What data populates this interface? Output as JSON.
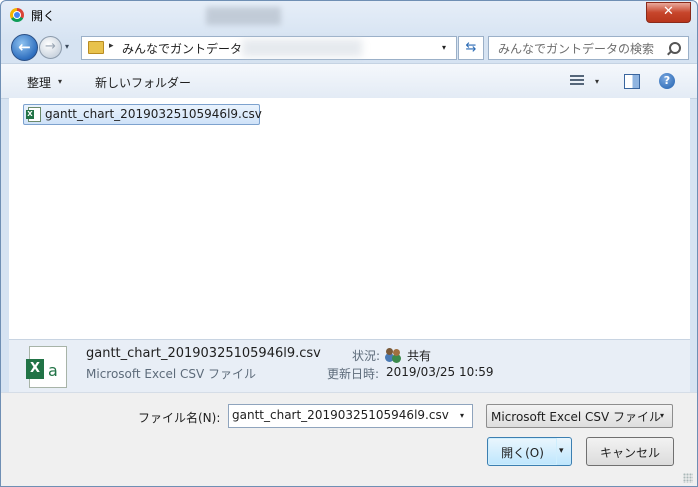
{
  "window": {
    "title": "開く",
    "close_glyph": "✕"
  },
  "address": {
    "breadcrumb_arrow": "▸",
    "path": "みんなでガントデータ",
    "dropdown_glyph": "▾",
    "refresh_glyph": "⇆"
  },
  "search": {
    "placeholder": "みんなでガントデータの検索"
  },
  "nav": {
    "back_glyph": "←",
    "forward_glyph": "→",
    "recent_glyph": "▾"
  },
  "toolbar": {
    "organize_label": "整理",
    "organize_caret": "▾",
    "new_folder_label": "新しいフォルダー",
    "view_caret": "▾",
    "help_glyph": "?"
  },
  "files": [
    {
      "name": "gantt_chart_20190325105946l9.csv",
      "selected": true
    }
  ],
  "details": {
    "name": "gantt_chart_20190325105946l9.csv",
    "type": "Microsoft Excel CSV ファイル",
    "status_label": "状況:",
    "status_value": "共有",
    "modified_label": "更新日時:",
    "modified_value": "2019/03/25 10:59"
  },
  "bottom": {
    "filename_label": "ファイル名(N):",
    "filename_value": "gantt_chart_20190325105946l9.csv",
    "filename_caret": "▾",
    "filetype_value": "Microsoft Excel CSV ファイル",
    "filetype_caret": "▾",
    "open_label": "開く(O)",
    "open_split_caret": "▾",
    "cancel_label": "キャンセル"
  },
  "colors": {
    "accent": "#3c7fb1",
    "close": "#c7462c",
    "excel_green": "#217346"
  }
}
